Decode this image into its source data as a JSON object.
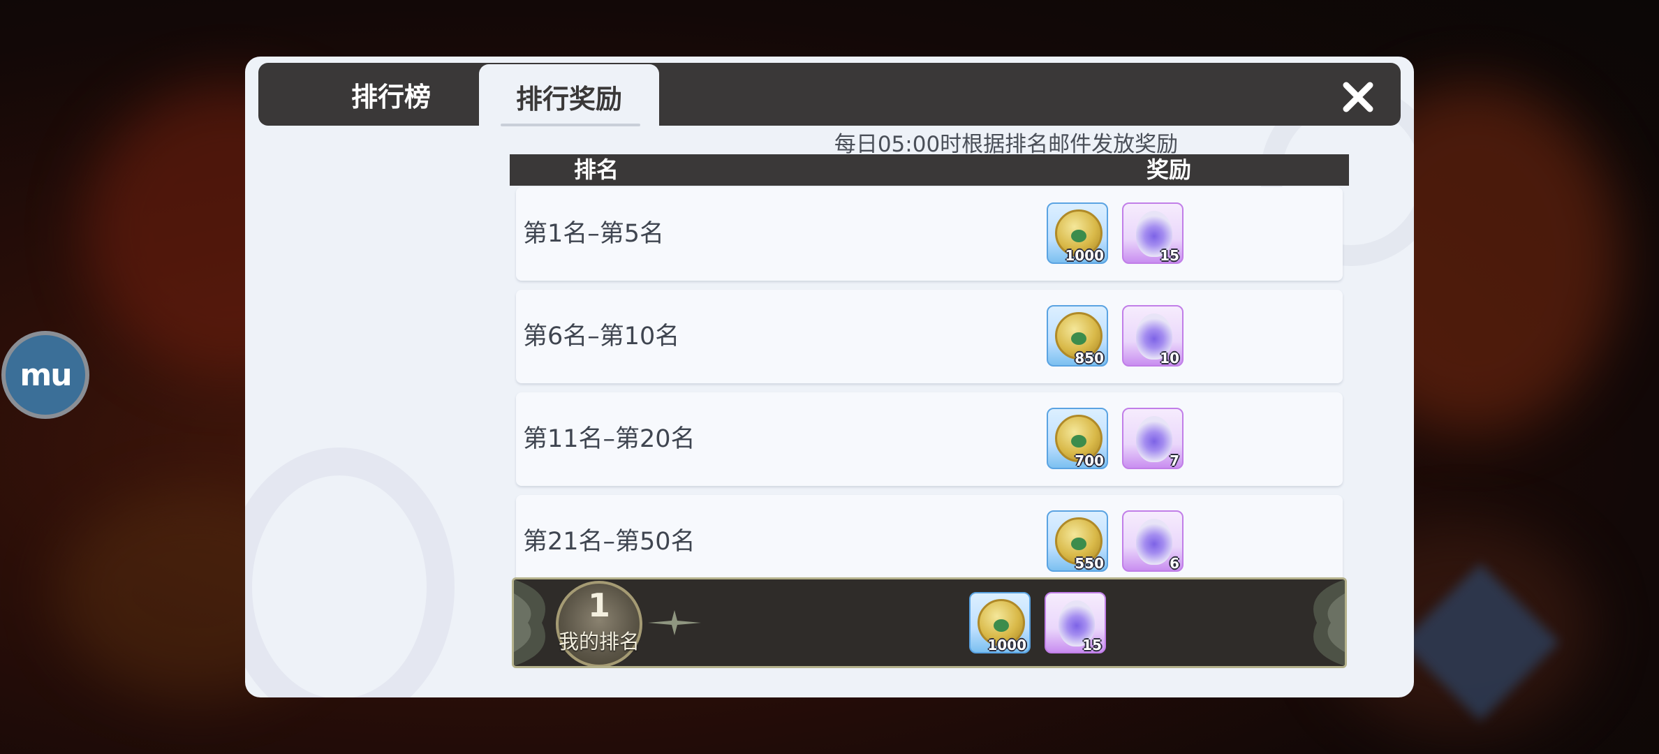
{
  "floating_logo": {
    "text": "mu"
  },
  "tabs": [
    {
      "label": "排行榜",
      "active": false
    },
    {
      "label": "排行奖励",
      "active": true
    }
  ],
  "notice": "每日05:00时根据排名邮件发放奖励",
  "table": {
    "columns": {
      "rank": "排名",
      "reward": "奖励"
    },
    "rows": [
      {
        "range": "第1名–第5名",
        "coin_qty": "1000",
        "gem_qty": "15"
      },
      {
        "range": "第6名–第10名",
        "coin_qty": "850",
        "gem_qty": "10"
      },
      {
        "range": "第11名–第20名",
        "coin_qty": "700",
        "gem_qty": "7"
      },
      {
        "range": "第21名–第50名",
        "coin_qty": "550",
        "gem_qty": "6"
      }
    ]
  },
  "my_rank": {
    "rank": "1",
    "label": "我的排名",
    "coin_qty": "1000",
    "gem_qty": "15"
  },
  "icons": {
    "close": "close-icon",
    "coin": "gold-coin-icon",
    "gem": "spirit-gem-icon"
  },
  "colors": {
    "tab_bar": "#3a3838",
    "panel": "#eef2f8",
    "coin_border": "#5aa3e2",
    "gem_border": "#c17ee8",
    "my_rank_border": "#b5b28c"
  }
}
